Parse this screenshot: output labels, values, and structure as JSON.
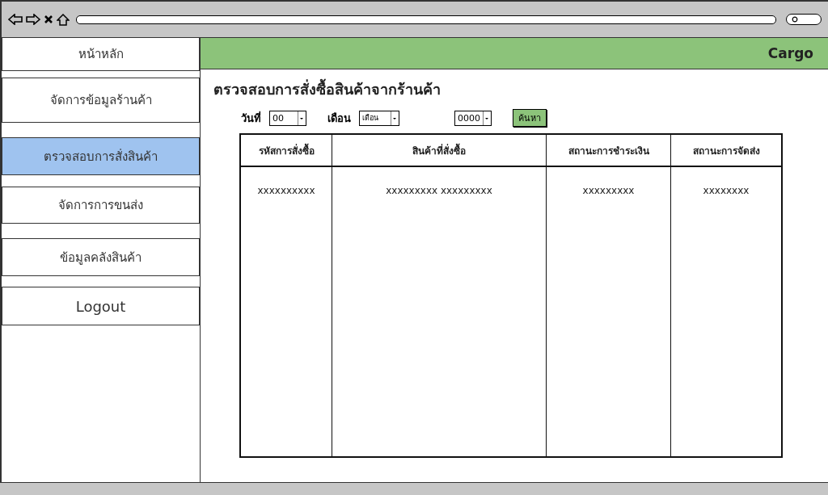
{
  "header": {
    "brand": "Cargo"
  },
  "sidebar": {
    "items": [
      {
        "label": "หน้าหลัก",
        "selected": false
      },
      {
        "label": "จัดการข้อมูลร้านค้า",
        "selected": false
      },
      {
        "label": "ตรวจสอบการสั่งสินค้า",
        "selected": true
      },
      {
        "label": "จัดการการขนส่ง",
        "selected": false
      },
      {
        "label": "ข้อมูลคลังสินค้า",
        "selected": false
      },
      {
        "label": "Logout",
        "selected": false
      }
    ]
  },
  "title": "ตรวจสอบการสั่งซื้อสินค้าจากร้านค้า",
  "filters": [
    {
      "label": "วันที่",
      "value": "00"
    },
    {
      "label": "เดือน",
      "value": "เดือน"
    },
    {
      "value": "0000"
    }
  ],
  "search_button": "ค้นหา",
  "table": {
    "columns": [
      "รหัสการสั่งซื้อ",
      "สินค้าที่สั่งซื้อ",
      "สถานะการชำระเงิน",
      "สถานะการจัดส่ง"
    ],
    "rows": [
      [
        "xxxxxxxxxx",
        "xxxxxxxxx xxxxxxxxx",
        "xxxxxxxxx",
        "xxxxxxxx"
      ]
    ]
  }
}
